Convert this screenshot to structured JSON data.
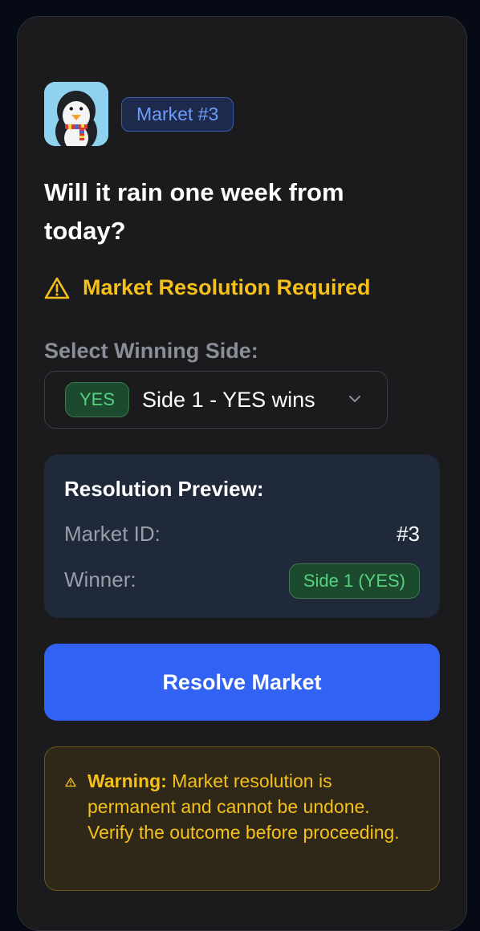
{
  "market": {
    "badge": "Market #3",
    "question": "Will it rain one week from today?"
  },
  "alert": {
    "icon": "warning-triangle-icon",
    "text": "Market Resolution Required"
  },
  "select": {
    "label": "Select Winning Side:",
    "pill": "YES",
    "selected": "Side 1 - YES wins",
    "icon": "chevron-down-icon"
  },
  "preview": {
    "title": "Resolution Preview:",
    "market_id_label": "Market ID:",
    "market_id_value": "#3",
    "winner_label": "Winner:",
    "winner_value": "Side 1 (YES)"
  },
  "action": {
    "resolve_label": "Resolve Market"
  },
  "warning": {
    "icon": "warning-triangle-icon",
    "lead": "Warning:",
    "text": " Market resolution is permanent and cannot be undone. Verify the outcome before proceeding."
  },
  "colors": {
    "accent": "#3162f4",
    "warning": "#f5c01a",
    "success": "#58d27e",
    "badge_blue": "#6e9cf8"
  }
}
